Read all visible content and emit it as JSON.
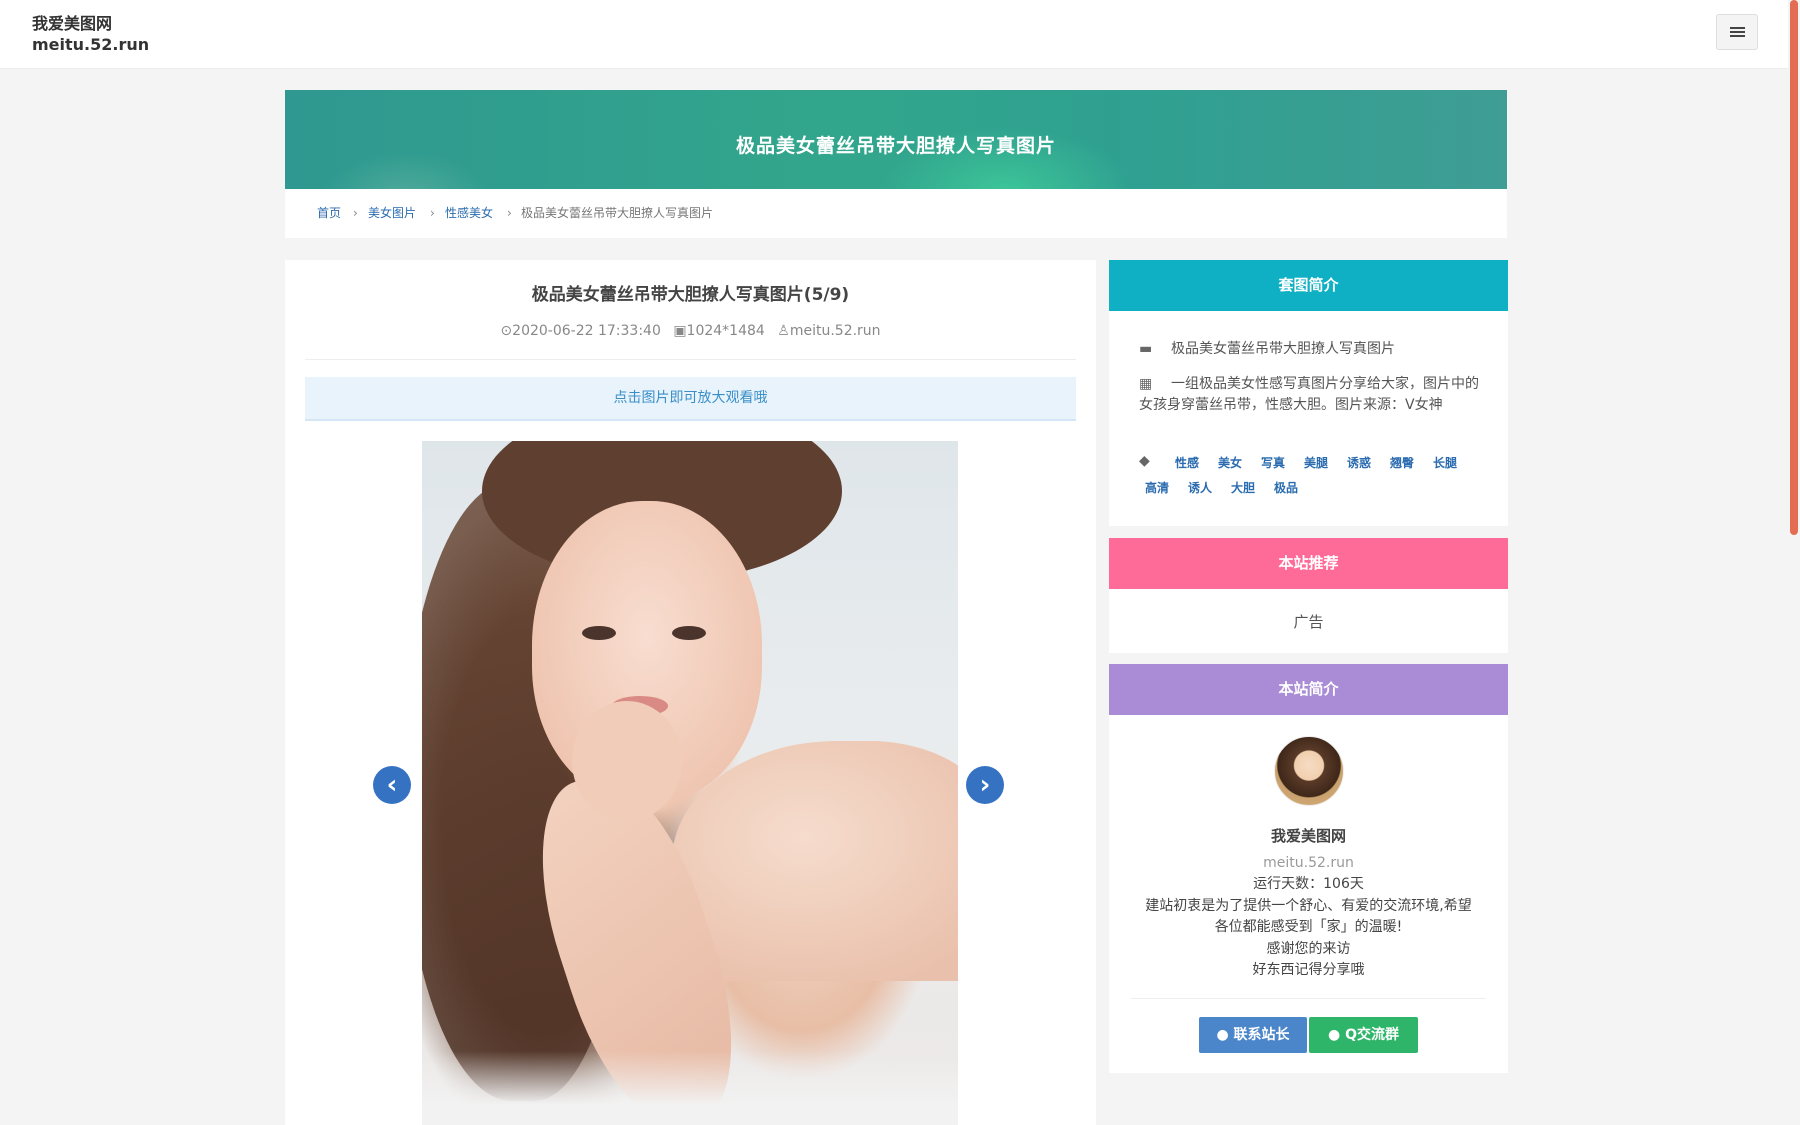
{
  "header": {
    "site_name": "我爱美图网",
    "site_domain": "meitu.52.run",
    "menu_icon": "list-icon"
  },
  "banner": {
    "title": "极品美女蕾丝吊带大胆撩人写真图片"
  },
  "breadcrumb": {
    "items": [
      "首页",
      "美女图片",
      "性感美女",
      "极品美女蕾丝吊带大胆撩人写真图片"
    ],
    "separator": "›"
  },
  "post": {
    "title": "极品美女蕾丝吊带大胆撩人写真图片(5/9)",
    "date": "2020-06-22 17:33:40",
    "size": "1024*1484",
    "author": "meitu.52.run",
    "notice": "点击图片即可放大观看哦",
    "prev_icon": "chevron-left-icon",
    "next_icon": "chevron-right-icon"
  },
  "sidebar": {
    "intro": {
      "heading": "套图简介",
      "color": "#0fb0c4",
      "name": "极品美女蕾丝吊带大胆撩人写真图片",
      "description": "一组极品美女性感写真图片分享给大家，图片中的女孩身穿蕾丝吊带，性感大胆。图片来源：V女神",
      "tags": [
        "性感",
        "美女",
        "写真",
        "美腿",
        "诱惑",
        "翘臀",
        "长腿",
        "高清",
        "诱人",
        "大胆",
        "极品"
      ]
    },
    "recommend": {
      "heading": "本站推荐",
      "color": "#ff6b99",
      "content": "广告"
    },
    "about": {
      "heading": "本站简介",
      "color": "#a98bd6",
      "name": "我爱美图网",
      "domain": "meitu.52.run",
      "days": "运行天数：106天",
      "line1": "建站初衷是为了提供一个舒心、有爱的交流环境,希望",
      "line2": "各位都能感受到「家」的温暖!",
      "line3": "感谢您的来访",
      "line4": "好东西记得分享哦",
      "btn_contact": "联系站长",
      "btn_contact_color": "#4a86c9",
      "btn_group": "Q交流群",
      "btn_group_color": "#2fb56a"
    }
  }
}
